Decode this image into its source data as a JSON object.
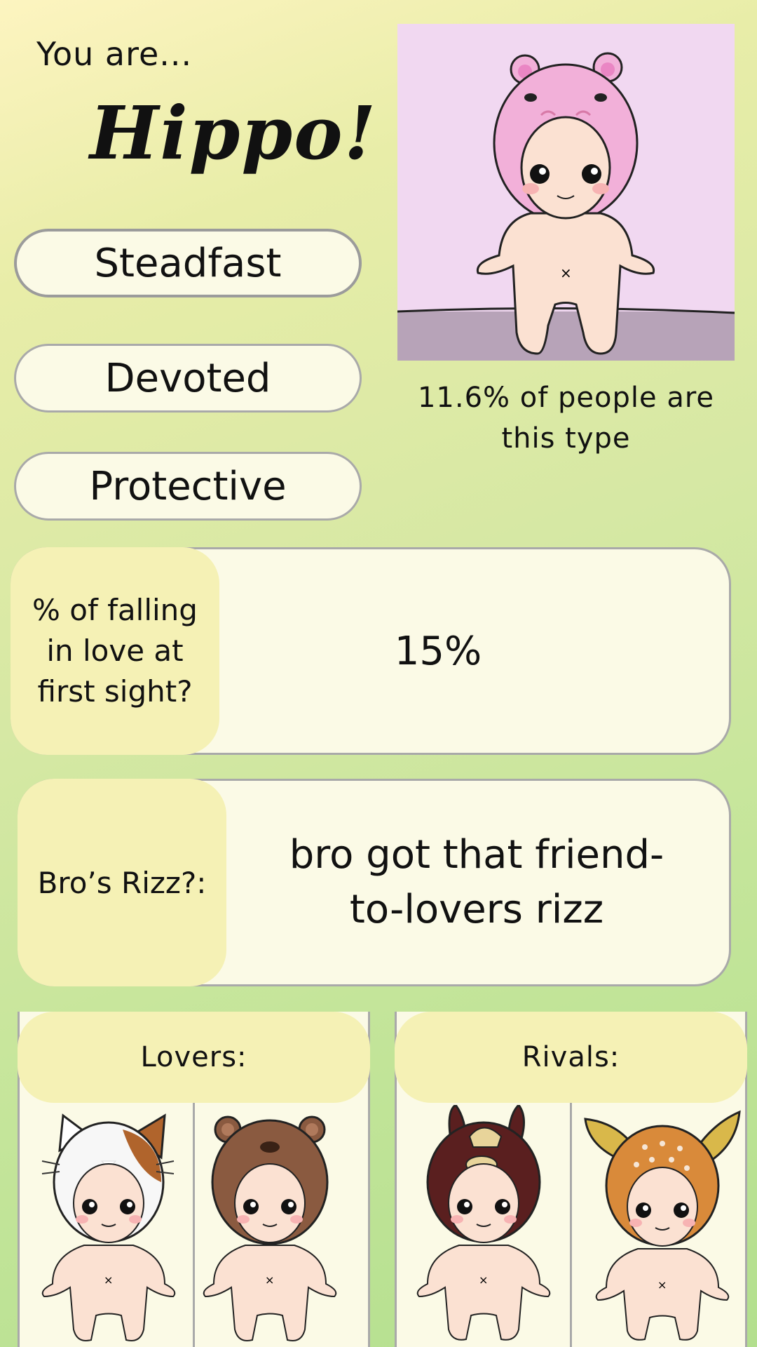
{
  "header": {
    "prefix": "You are...",
    "type_name": "Hippo!"
  },
  "traits": [
    "Steadfast",
    "Devoted",
    "Protective"
  ],
  "stat_text": "11.6% of people are this type",
  "questions": [
    {
      "label": "% of falling in love at first sight?",
      "value": "15%"
    },
    {
      "label": "Bro’s Rizz?:",
      "value": "bro got that friend-to-lovers rizz"
    }
  ],
  "lovers": {
    "title": "Lovers:",
    "characters": [
      "cat-doll-icon",
      "bear-doll-icon"
    ]
  },
  "rivals": {
    "title": "Rivals:",
    "characters": [
      "horse-doll-icon",
      "deer-doll-icon"
    ]
  },
  "colors": {
    "hippo": "#f2b0d9",
    "cat_patch": "#b0642c",
    "bear": "#8a5a40",
    "horse": "#5a1f1f",
    "deer": "#d98a3a",
    "label_bg": "#f5f1b5",
    "card_bg": "#fbfae6"
  }
}
